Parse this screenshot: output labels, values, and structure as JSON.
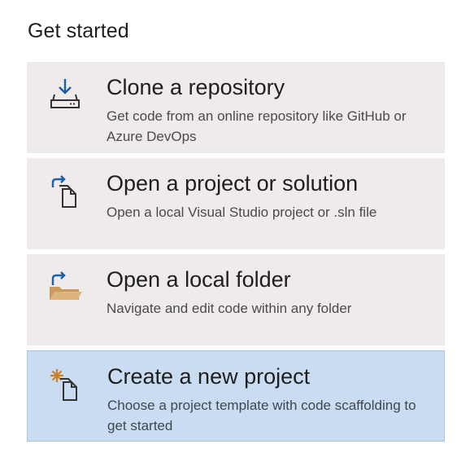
{
  "section": {
    "title": "Get started"
  },
  "cards": [
    {
      "title": "Clone a repository",
      "description": "Get code from an online repository like GitHub or Azure DevOps",
      "icon": "clone-download-icon"
    },
    {
      "title": "Open a project or solution",
      "description": "Open a local Visual Studio project or .sln file",
      "icon": "open-project-icon"
    },
    {
      "title": "Open a local folder",
      "description": "Navigate and edit code within any folder",
      "icon": "open-folder-icon"
    },
    {
      "title": "Create a new project",
      "description": "Choose a project template with code scaffolding to get started",
      "icon": "new-project-icon",
      "selected": true
    }
  ],
  "colors": {
    "card_background": "#efebea",
    "selected_background": "#cadcf2",
    "icon_blue": "#1b5fa8",
    "icon_dark": "#333333",
    "folder_tan": "#d8b07a",
    "spark_orange": "#c7822a"
  }
}
